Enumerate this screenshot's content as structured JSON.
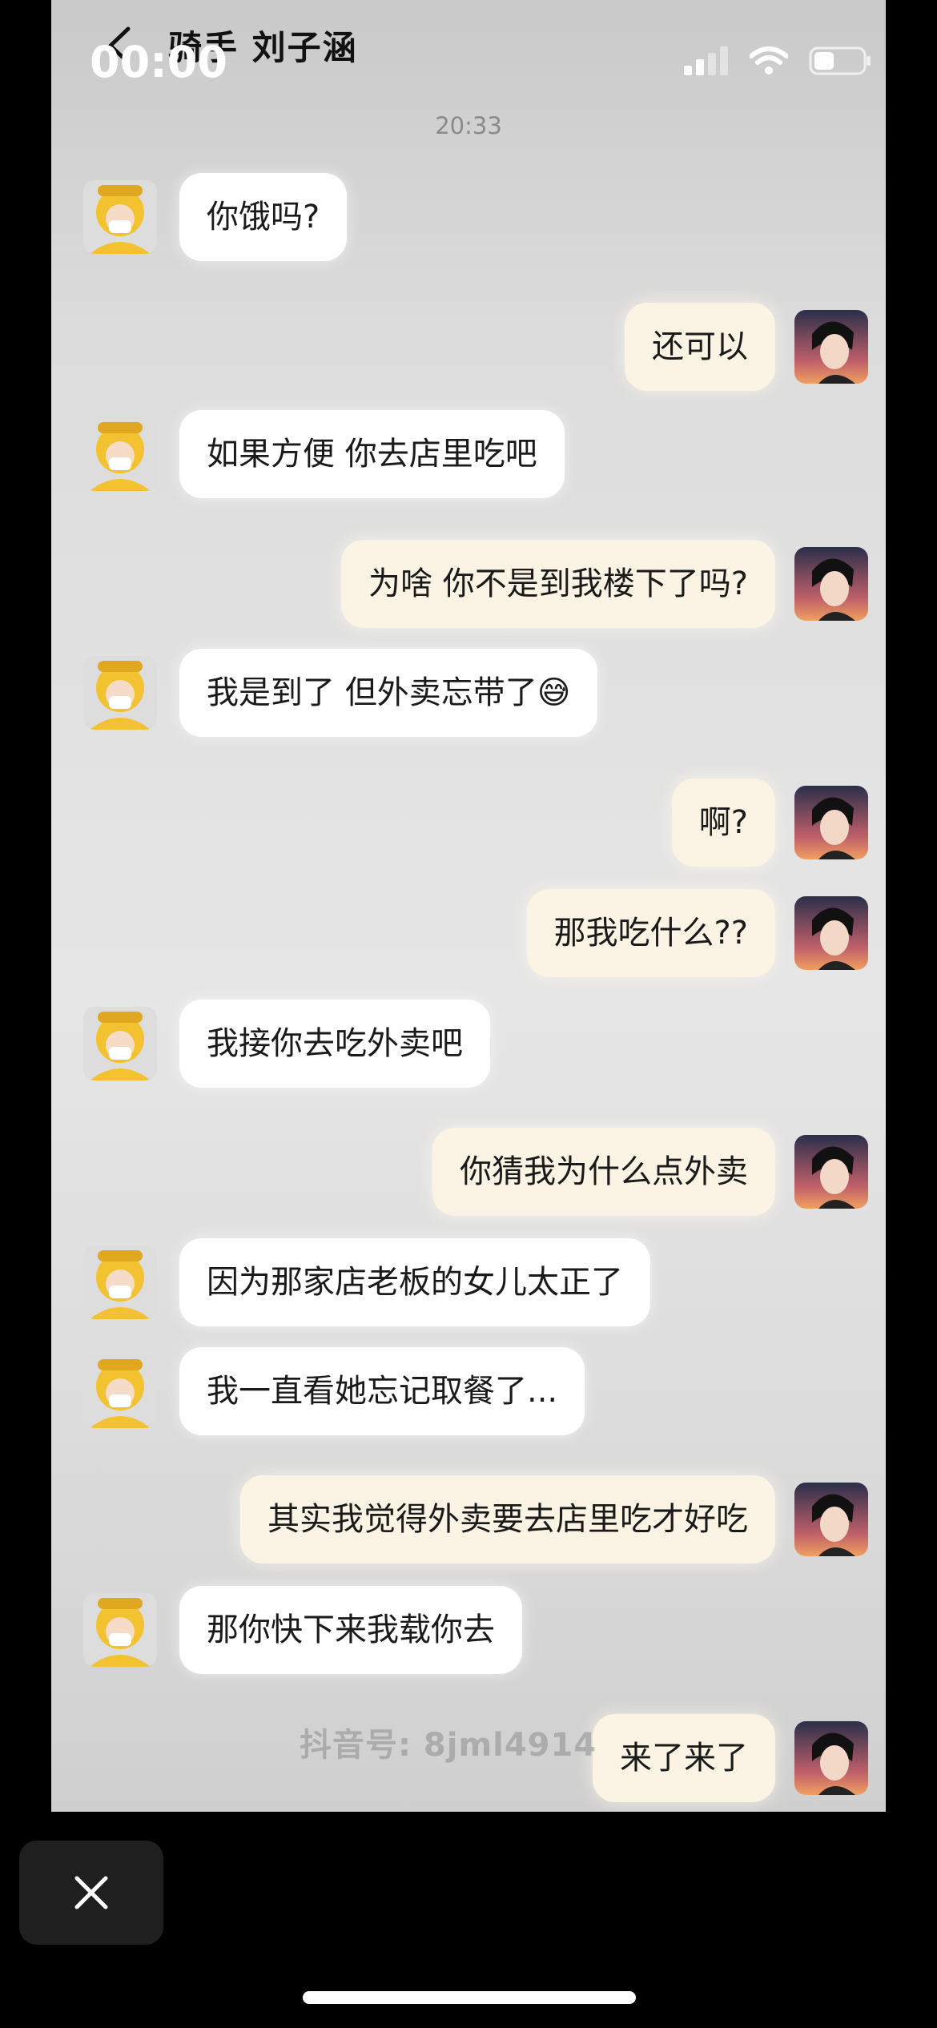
{
  "status_bar": {
    "time": "00:00"
  },
  "chat": {
    "title": "骑手 刘子涵",
    "timestamp": "20:33",
    "messages": [
      {
        "side": "left",
        "text": "你饿吗?"
      },
      {
        "side": "right",
        "text": "还可以"
      },
      {
        "side": "left",
        "text": "如果方便 你去店里吃吧"
      },
      {
        "side": "right",
        "text": "为啥 你不是到我楼下了吗?"
      },
      {
        "side": "left",
        "text": "我是到了 但外卖忘带了😅"
      },
      {
        "side": "right",
        "text": "啊?"
      },
      {
        "side": "right",
        "text": "那我吃什么??"
      },
      {
        "side": "left",
        "text": "我接你去吃外卖吧"
      },
      {
        "side": "right",
        "text": "你猜我为什么点外卖"
      },
      {
        "side": "left",
        "text": "因为那家店老板的女儿太正了"
      },
      {
        "side": "left",
        "text": "我一直看她忘记取餐了..."
      },
      {
        "side": "right",
        "text": "其实我觉得外卖要去店里吃才好吃"
      },
      {
        "side": "left",
        "text": "那你快下来我载你去"
      },
      {
        "side": "right",
        "text": "来了来了"
      }
    ],
    "watermark": "抖音号: 8jml4914"
  },
  "icons": {
    "back": "chevron-left-icon",
    "signal": "signal-icon",
    "wifi": "wifi-icon",
    "battery": "battery-icon",
    "close": "close-icon"
  },
  "colors": {
    "left_bubble": "#ffffff",
    "right_bubble": "#fbf3e3",
    "rider_helmet": "#f2c230"
  }
}
